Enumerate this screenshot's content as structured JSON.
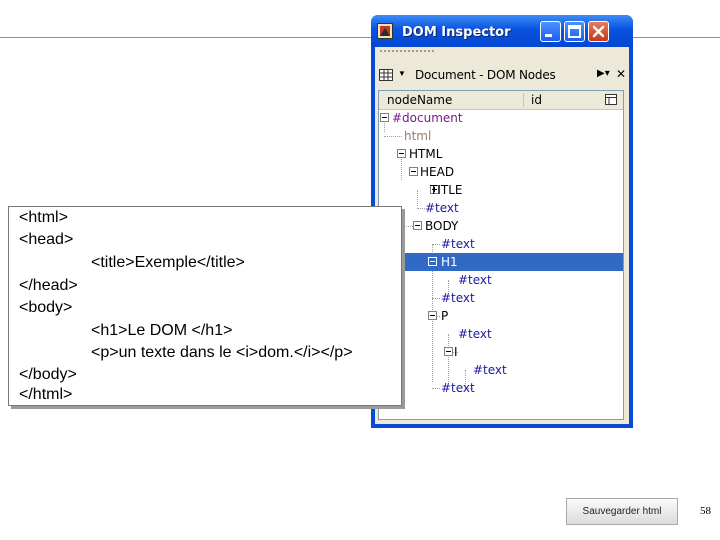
{
  "window": {
    "title": "DOM Inspector",
    "panel_title": "Document - DOM Nodes",
    "columns": {
      "node_name": "nodeName",
      "id": "id"
    },
    "selected_node": "H1",
    "tree": [
      {
        "label": "#document",
        "twisty": "minus",
        "color": "#7a1a8a"
      },
      {
        "label": "html",
        "twisty": "",
        "color": "#9a7a6a"
      },
      {
        "label": "HTML",
        "twisty": "minus",
        "color": "#000000"
      },
      {
        "label": "HEAD",
        "twisty": "minus",
        "color": "#000000"
      },
      {
        "label": "TITLE",
        "twisty": "plus",
        "color": "#000000"
      },
      {
        "label": "#text",
        "twisty": "",
        "color": "#1a1aa0"
      },
      {
        "label": "BODY",
        "twisty": "minus",
        "color": "#000000"
      },
      {
        "label": "#text",
        "twisty": "",
        "color": "#1a1aa0"
      },
      {
        "label": "H1",
        "twisty": "minus",
        "color": "#ffffff"
      },
      {
        "label": "#text",
        "twisty": "",
        "color": "#1a1aa0"
      },
      {
        "label": "#text",
        "twisty": "",
        "color": "#1a1aa0"
      },
      {
        "label": "P",
        "twisty": "minus",
        "color": "#000000"
      },
      {
        "label": "#text",
        "twisty": "",
        "color": "#1a1aa0"
      },
      {
        "label": "I",
        "twisty": "minus",
        "color": "#000000"
      },
      {
        "label": "#text",
        "twisty": "",
        "color": "#1a1aa0"
      },
      {
        "label": "#text",
        "twisty": "",
        "color": "#1a1aa0"
      }
    ]
  },
  "source_code": {
    "lines": [
      "<html>",
      "<head>",
      "<title>Exemple</title>",
      "</head>",
      "<body>",
      "<h1>Le DOM </h1>",
      "<p>un texte dans le <i>dom.</i></p>",
      "</body>",
      "</html>"
    ]
  },
  "save_button": {
    "label": "Sauvegarder html"
  },
  "page_number": "58",
  "colors": {
    "selection": "#316ac5",
    "title_bar": "#0a53e0",
    "close_button": "#c4391b"
  }
}
